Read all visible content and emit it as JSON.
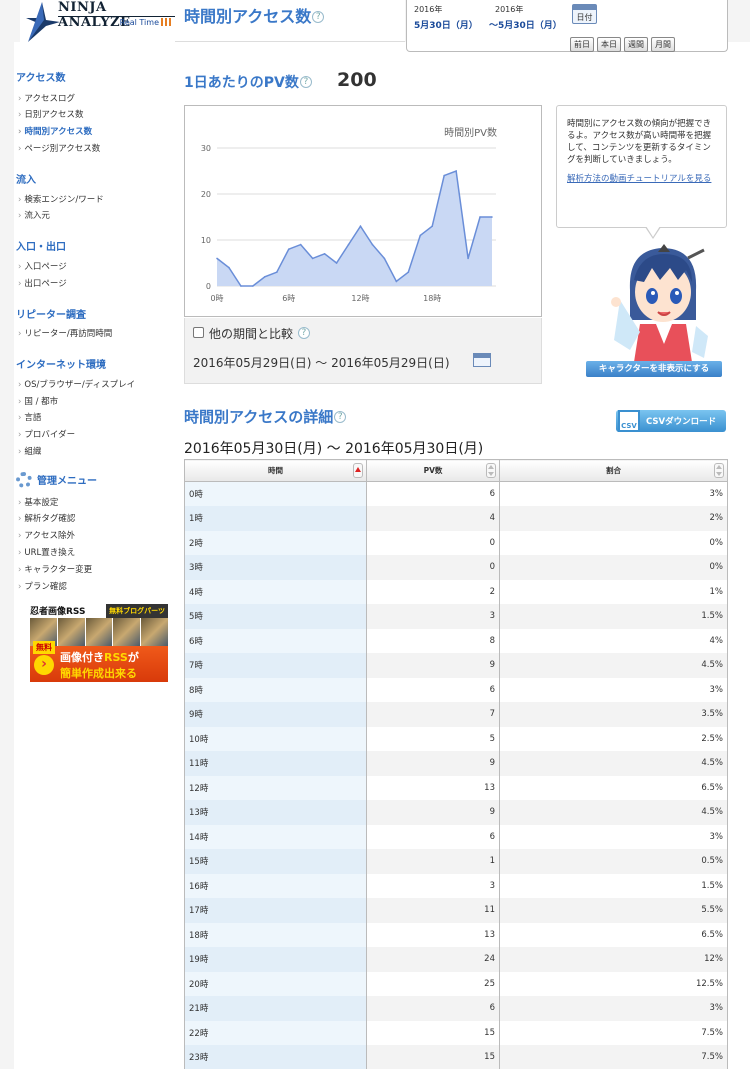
{
  "brand": {
    "name": "NINJA ANALYZE",
    "tagline": "Real Time"
  },
  "page": {
    "title": "時間別アクセス数",
    "help": "?"
  },
  "date_picker": {
    "start_year": "2016年",
    "start_date": "5月30日（月）",
    "end_year": "2016年",
    "end_date": "〜5月30日（月）",
    "calendar_label": "日付",
    "buttons": [
      "前日",
      "本日",
      "週間",
      "月間"
    ]
  },
  "sidebar": {
    "sections": [
      {
        "heading": "アクセス数",
        "items": [
          "アクセスログ",
          "日別アクセス数",
          "時間別アクセス数",
          "ページ別アクセス数"
        ]
      },
      {
        "heading": "流入",
        "items": [
          "検索エンジン/ワード",
          "流入元"
        ]
      },
      {
        "heading": "入口・出口",
        "items": [
          "入口ページ",
          "出口ページ"
        ]
      },
      {
        "heading": "リピーター調査",
        "items": [
          "リピーター/再訪問時間"
        ]
      },
      {
        "heading": "インターネット環境",
        "items": [
          "OS/ブラウザー/ディスプレイ",
          "国 / 都市",
          "言語",
          "プロバイダー",
          "組織"
        ]
      },
      {
        "heading": "管理メニュー",
        "items": [
          "基本設定",
          "解析タグ確認",
          "アクセス除外",
          "URL置き換え",
          "キャラクター変更",
          "プラン確認"
        ]
      }
    ],
    "active_item": "時間別アクセス数"
  },
  "ad": {
    "brand": "忍者画像RSS",
    "tag": "無料ブログパーツ",
    "free_badge": "無料",
    "line1_prefix": "画像付き",
    "line1_emph": "RSS",
    "line1_suffix": "が",
    "line2": "簡単作成出来る"
  },
  "pv_summary": {
    "label": "1日あたりのPV数",
    "total": "200"
  },
  "chart_data": {
    "type": "area",
    "title": "時間別PV数",
    "x": [
      0,
      1,
      2,
      3,
      4,
      5,
      6,
      7,
      8,
      9,
      10,
      11,
      12,
      13,
      14,
      15,
      16,
      17,
      18,
      19,
      20,
      21,
      22,
      23
    ],
    "x_tick_labels": [
      "0時",
      "6時",
      "12時",
      "18時"
    ],
    "x_ticks": [
      0,
      6,
      12,
      18
    ],
    "values": [
      6,
      4,
      0,
      0,
      2,
      3,
      8,
      9,
      6,
      7,
      5,
      9,
      13,
      9,
      6,
      1,
      3,
      11,
      13,
      24,
      25,
      6,
      15,
      15
    ],
    "ylim": [
      0,
      30
    ],
    "y_ticks": [
      0,
      10,
      20,
      30
    ],
    "grid": true,
    "fill_color": "#c9d8f4",
    "line_color": "#6a8ed8"
  },
  "compare": {
    "label": "他の期間と比較",
    "range": "2016年05月29日(日) 〜 2016年05月29日(日)"
  },
  "tip": {
    "text": "時間別にアクセス数の傾向が把握できるよ。アクセス数が高い時間帯を把握して、コンテンツを更新するタイミングを判断していきましょう。",
    "link": "解析方法の動画チュートリアルを見る"
  },
  "character_button": "キャラクターを非表示にする",
  "detail": {
    "title": "時間別アクセスの詳細",
    "range": "2016年05月30日(月) 〜 2016年05月30日(月)",
    "csv_icon": "CSV",
    "csv_label": "CSVダウンロード",
    "columns": [
      "時間",
      "PV数",
      "割合"
    ],
    "rows": [
      [
        "0時",
        "6",
        "3%"
      ],
      [
        "1時",
        "4",
        "2%"
      ],
      [
        "2時",
        "0",
        "0%"
      ],
      [
        "3時",
        "0",
        "0%"
      ],
      [
        "4時",
        "2",
        "1%"
      ],
      [
        "5時",
        "3",
        "1.5%"
      ],
      [
        "6時",
        "8",
        "4%"
      ],
      [
        "7時",
        "9",
        "4.5%"
      ],
      [
        "8時",
        "6",
        "3%"
      ],
      [
        "9時",
        "7",
        "3.5%"
      ],
      [
        "10時",
        "5",
        "2.5%"
      ],
      [
        "11時",
        "9",
        "4.5%"
      ],
      [
        "12時",
        "13",
        "6.5%"
      ],
      [
        "13時",
        "9",
        "4.5%"
      ],
      [
        "14時",
        "6",
        "3%"
      ],
      [
        "15時",
        "1",
        "0.5%"
      ],
      [
        "16時",
        "3",
        "1.5%"
      ],
      [
        "17時",
        "11",
        "5.5%"
      ],
      [
        "18時",
        "13",
        "6.5%"
      ],
      [
        "19時",
        "24",
        "12%"
      ],
      [
        "20時",
        "25",
        "12.5%"
      ],
      [
        "21時",
        "6",
        "3%"
      ],
      [
        "22時",
        "15",
        "7.5%"
      ],
      [
        "23時",
        "15",
        "7.5%"
      ]
    ]
  }
}
